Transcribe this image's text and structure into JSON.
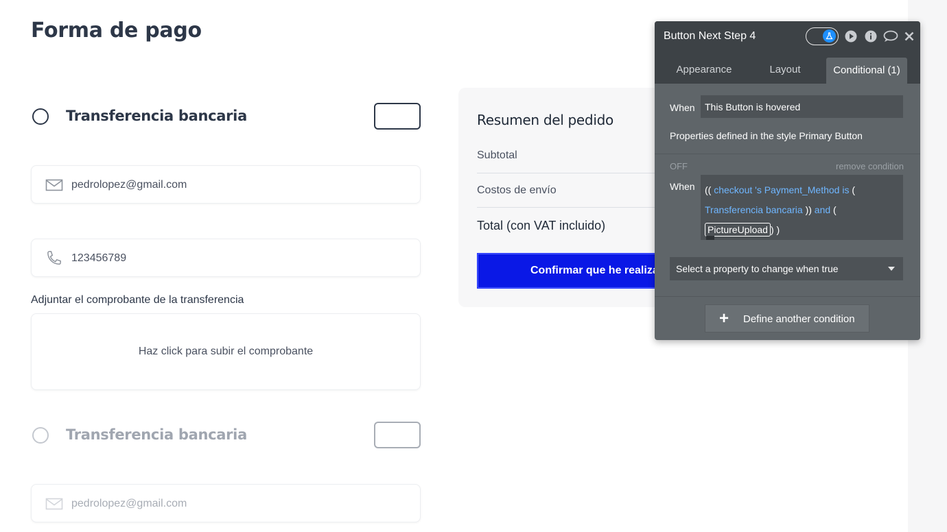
{
  "page": {
    "title": "Forma de pago",
    "method_1": {
      "label": "Transferencia bancaria"
    },
    "email_field": {
      "value": "pedrolopez@gmail.com"
    },
    "phone_field": {
      "value": "123456789"
    },
    "upload": {
      "label": "Adjuntar el comprobante de la transferencia",
      "prompt": "Haz click para subir el comprobante"
    },
    "method_2": {
      "label": "Transferencia bancaria"
    },
    "email_field_2": {
      "value": "pedrolopez@gmail.com"
    }
  },
  "summary": {
    "title": "Resumen del pedido",
    "subtotal_label": "Subtotal",
    "shipping_label": "Costos de envío",
    "total_label": "Total (con VAT incluido)",
    "confirm_button": "Confirmar que he realiza"
  },
  "inspector": {
    "title": "Button Next Step 4",
    "tabs": [
      {
        "label": "Appearance"
      },
      {
        "label": "Layout"
      },
      {
        "label": "Conditional (1)"
      }
    ],
    "active_tab": "Conditional (1)",
    "condition_1": {
      "when_label": "When",
      "when_value": "This Button is hovered",
      "properties_note": "Properties defined in the style Primary Button"
    },
    "condition_2": {
      "state": "OFF",
      "remove_label": "remove condition",
      "when_label": "When",
      "expr_open": "((",
      "expr_source": "checkout",
      "expr_field": "'s Payment_Method",
      "expr_op": "is",
      "expr_paren": "(",
      "expr_value": "Transferencia bancaria",
      "expr_close": "))",
      "expr_and": "and",
      "expr_paren2": "(",
      "expr_element": "PictureUpload",
      "expr_end": ") )"
    },
    "property_select": {
      "placeholder": "Select a property to change when true"
    },
    "define_button": "Define another condition",
    "colors": {
      "panel_bg": "#5f6569",
      "header_bg": "#3d4246",
      "token_blue": "#6fb6ff",
      "toggle_blue": "#1e90ff"
    },
    "icons": [
      "flask-icon",
      "play-icon",
      "info-icon",
      "comment-icon",
      "close-icon"
    ]
  }
}
